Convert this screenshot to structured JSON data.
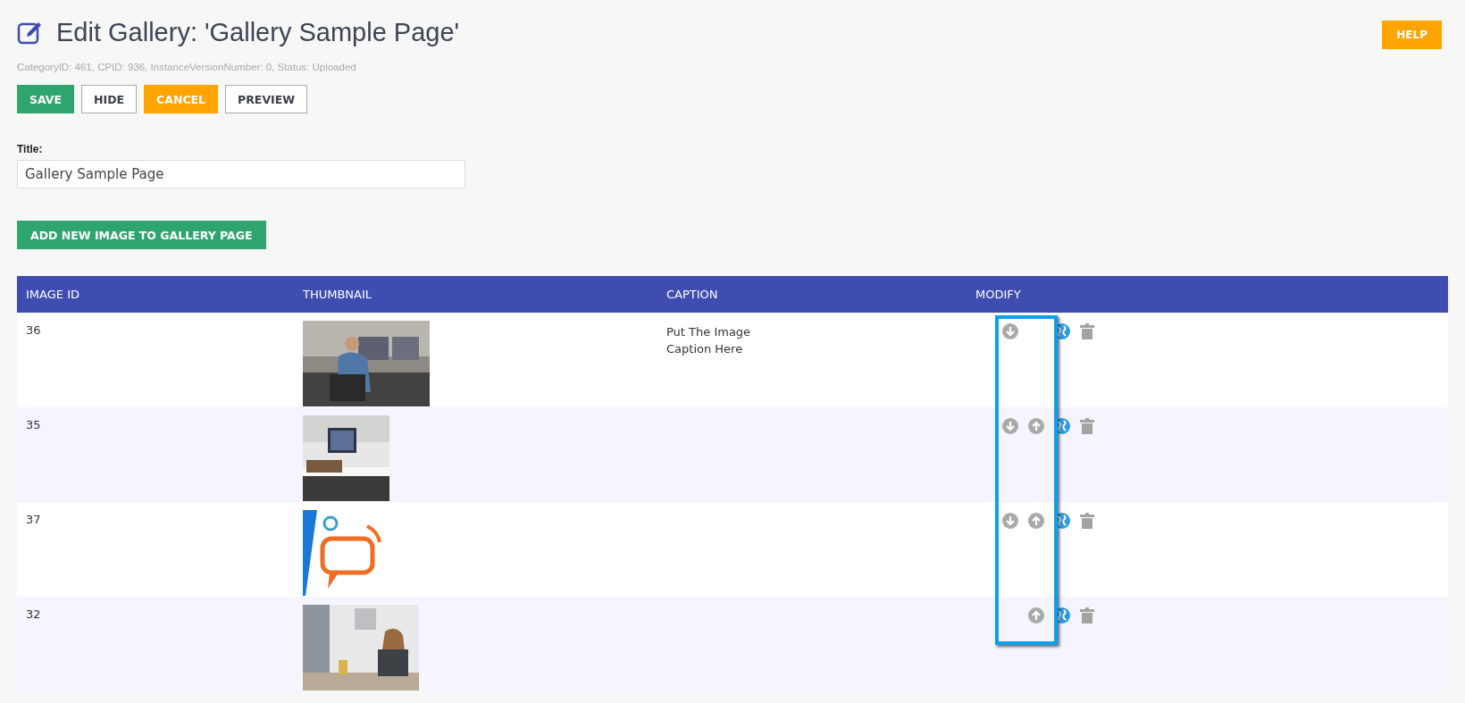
{
  "header": {
    "title": "Edit Gallery: 'Gallery Sample Page'",
    "meta": "CategoryID: 461, CPID: 936, InstanceVersionNumber: 0, Status: Uploaded",
    "help": "HELP"
  },
  "actions": [
    {
      "label": "SAVE",
      "kind": "primary"
    },
    {
      "label": "HIDE",
      "kind": "outline"
    },
    {
      "label": "CANCEL",
      "kind": "warning"
    },
    {
      "label": "PREVIEW",
      "kind": "outline"
    }
  ],
  "title_field": {
    "label": "Title:",
    "value": "Gallery Sample Page"
  },
  "add_button": "ADD NEW IMAGE TO GALLERY PAGE",
  "table": {
    "columns": [
      "IMAGE ID",
      "THUMBNAIL",
      "CAPTION",
      "MODIFY"
    ],
    "modify_highlight": true,
    "rows": [
      {
        "image_id": "36",
        "caption": [
          "Put The Image",
          "Caption Here"
        ],
        "can_move_down": true,
        "can_move_up": false
      },
      {
        "image_id": "35",
        "caption": [],
        "can_move_down": true,
        "can_move_up": true
      },
      {
        "image_id": "37",
        "caption": [],
        "can_move_down": true,
        "can_move_up": true
      },
      {
        "image_id": "32",
        "caption": [],
        "can_move_down": false,
        "can_move_up": true
      }
    ]
  }
}
